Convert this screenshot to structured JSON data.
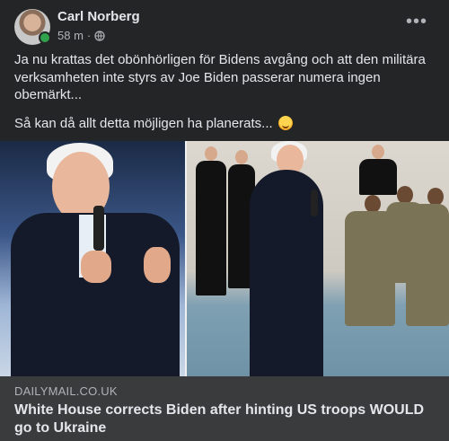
{
  "post": {
    "author": "Carl Norberg",
    "time": "58 m",
    "meta_sep": "·",
    "more_icon": "more-horizontal-icon",
    "privacy_icon": "globe-icon",
    "paragraphs": [
      "Ja nu krattas det obönhörligen för Bidens avgång och att den militära verksamheten inte styrs av Joe Biden passerar numera ingen obemärkt...",
      "Så kan då allt detta möjligen ha planerats..."
    ],
    "emoji": "smiling-face-icon"
  },
  "link": {
    "source": "DAILYMAIL.CO.UK",
    "headline": "White House corrects Biden after hinting US troops WOULD go to Ukraine"
  },
  "colors": {
    "background": "#242526",
    "card": "#3a3b3c",
    "text": "#e4e6eb",
    "secondary": "#b0b3b8",
    "online": "#31a24c"
  }
}
